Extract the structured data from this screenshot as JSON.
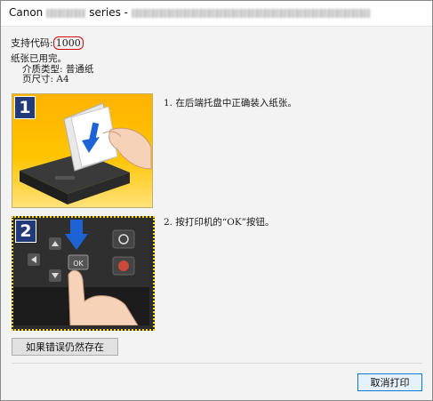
{
  "window": {
    "title_prefix": "Canon",
    "title_series": "series -",
    "title_blurred_1": "",
    "title_blurred_2": ""
  },
  "support": {
    "label": "支持代码:",
    "code": "1000"
  },
  "message": {
    "line1": "纸张已用完。",
    "media_type": "介质类型: 普通纸",
    "page_size": "页尺寸: A4"
  },
  "steps": [
    {
      "number": "1",
      "text": "1.  在后端托盘中正确装入纸张。"
    },
    {
      "number": "2",
      "text": "2.  按打印机的“OK”按钮。"
    }
  ],
  "panel_keys": {
    "ok": "OK"
  },
  "buttons": {
    "persist": "如果错误仍然存在",
    "cancel": "取消打印"
  },
  "colors": {
    "step_badge": "#233a7a",
    "code_outline": "#d40000",
    "step1_bg": "#ffc400",
    "arrow_blue": "#1e63d6"
  }
}
